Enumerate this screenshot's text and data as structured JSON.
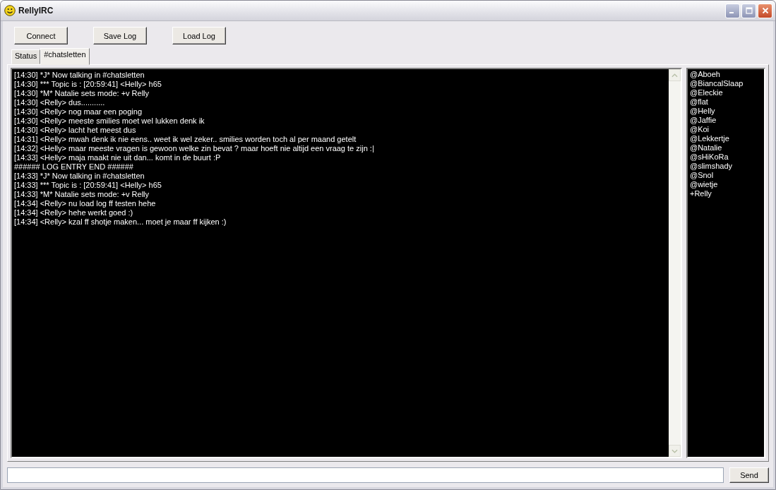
{
  "window": {
    "title": "RellyIRC"
  },
  "toolbar": [
    "Connect",
    "Save Log",
    "Load Log"
  ],
  "tabs": [
    {
      "label": "Status",
      "selected": false
    },
    {
      "label": "#chatsletten",
      "selected": true
    }
  ],
  "chat_lines": [
    "[14:30] *J* Now talking in #chatsletten",
    "[14:30] *** Topic is : [20:59:41] <Helly> h65",
    "[14:30] *M* Natalie sets mode: +v Relly",
    "[14:30] <Relly> dus...........",
    "[14:30] <Relly> nog maar een poging",
    "[14:30] <Relly> meeste smilies moet wel lukken denk ik",
    "[14:30] <Relly> lacht het meest dus",
    "[14:31] <Relly> mwah denk ik nie eens.. weet ik wel zeker.. smilies worden toch al per maand getelt",
    "[14:32] <Helly> maar meeste vragen is gewoon welke zin bevat ? maar hoeft nie altijd een vraag te zijn :|",
    "[14:33] <Helly> maja maakt nie uit dan... komt in de buurt :P",
    "###### LOG ENTRY END ######",
    "[14:33] *J* Now talking in #chatsletten",
    "[14:33] *** Topic is : [20:59:41] <Helly> h65",
    "[14:33] *M* Natalie sets mode: +v Relly",
    "[14:34] <Relly> nu load log ff testen hehe",
    "[14:34] <Relly> hehe werkt goed :)",
    "[14:34] <Relly> kzal ff shotje maken... moet je maar ff kijken :)"
  ],
  "users": [
    "@Aboeh",
    "@BiancalSlaap",
    "@Eleckie",
    "@flat",
    "@Helly",
    "@Jaffie",
    "@Koi",
    "@Lekkertje",
    "@Natalie",
    "@sHiKoRa",
    "@slimshady",
    "@Snol",
    "@wietje",
    "+Relly"
  ],
  "send_button": "Send"
}
